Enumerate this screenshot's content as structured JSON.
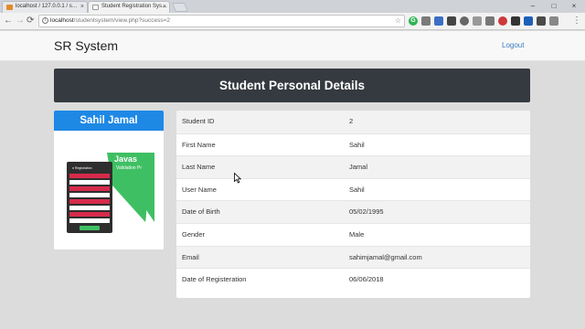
{
  "browser": {
    "tabs": [
      {
        "title": "localhost / 127.0.0.1 / s…",
        "active": false
      },
      {
        "title": "Student Registration Sys…",
        "active": true
      }
    ],
    "url_host": "localhost",
    "url_path": "/studentsystem/view.php?success=2",
    "icons": {
      "info": "i",
      "back": "←",
      "forward": "→",
      "reload": "⟳",
      "star": "☆",
      "close": "×",
      "minimize": "–",
      "maximize": "□",
      "menu": "⋮"
    }
  },
  "navbar": {
    "brand": "SR System",
    "logout": "Logout"
  },
  "page": {
    "title": "Student Personal Details",
    "profile_name": "Sahil Jamal",
    "photo_text": {
      "brand": "Javas",
      "sub": "Validation Pr",
      "form_title": "n Registration"
    }
  },
  "details": [
    {
      "label": "Student ID",
      "value": "2"
    },
    {
      "label": "First Name",
      "value": "Sahil"
    },
    {
      "label": "Last Name",
      "value": "Jamal"
    },
    {
      "label": "User Name",
      "value": "Sahil"
    },
    {
      "label": "Date of Birth",
      "value": "05/02/1995"
    },
    {
      "label": "Gender",
      "value": "Male"
    },
    {
      "label": "Email",
      "value": "sahimjamal@gmail.com"
    },
    {
      "label": "Date of Registeration",
      "value": "06/06/2018"
    }
  ],
  "colors": {
    "header_bg": "#353a40",
    "profile_name_bg": "#1e88e5",
    "link": "#3a7cc1",
    "photo_green": "#3fbf63",
    "photo_red": "#d62b4b"
  }
}
